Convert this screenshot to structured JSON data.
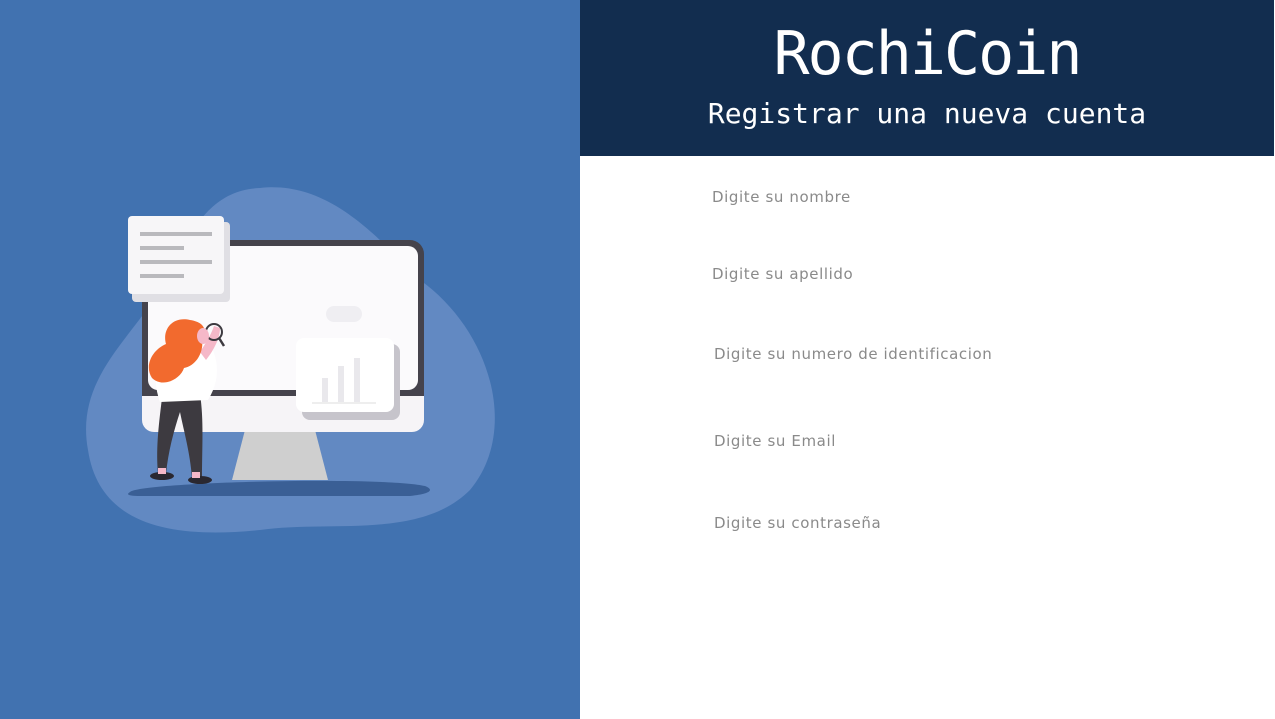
{
  "header": {
    "title": "RochiCoin",
    "subtitle": "Registrar una nueva cuenta"
  },
  "form": {
    "fields": [
      {
        "placeholder": "Digite su nombre",
        "value": ""
      },
      {
        "placeholder": "Digite su apellido",
        "value": ""
      },
      {
        "placeholder": "Digite su numero de identificacion",
        "value": ""
      },
      {
        "placeholder": "Digite su Email",
        "value": ""
      },
      {
        "placeholder": "Digite su contraseña",
        "value": ""
      }
    ]
  },
  "colors": {
    "left_panel": "#4172b0",
    "header_bg": "#122d4f",
    "placeholder": "#8a8a8a",
    "hair": "#f26a2e"
  },
  "illustration": {
    "icon": "woman-inspecting-monitor-illustration"
  }
}
